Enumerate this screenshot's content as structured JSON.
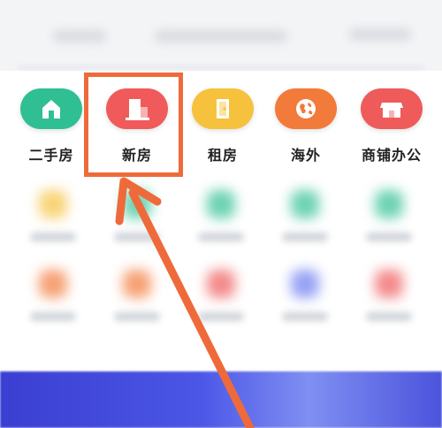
{
  "categories": [
    {
      "id": "second-hand",
      "label": "二手房",
      "icon": "house-icon",
      "color": "#2fbf93"
    },
    {
      "id": "new-house",
      "label": "新房",
      "icon": "building-icon",
      "color": "#f05a5a"
    },
    {
      "id": "rental",
      "label": "租房",
      "icon": "door-icon",
      "color": "#f6c23e"
    },
    {
      "id": "overseas",
      "label": "海外",
      "icon": "globe-icon",
      "color": "#f27a3a"
    },
    {
      "id": "commercial",
      "label": "商铺办公",
      "icon": "shop-icon",
      "color": "#ef5a5a"
    }
  ],
  "highlight": {
    "target": "new-house",
    "color": "#ef6a3a"
  }
}
